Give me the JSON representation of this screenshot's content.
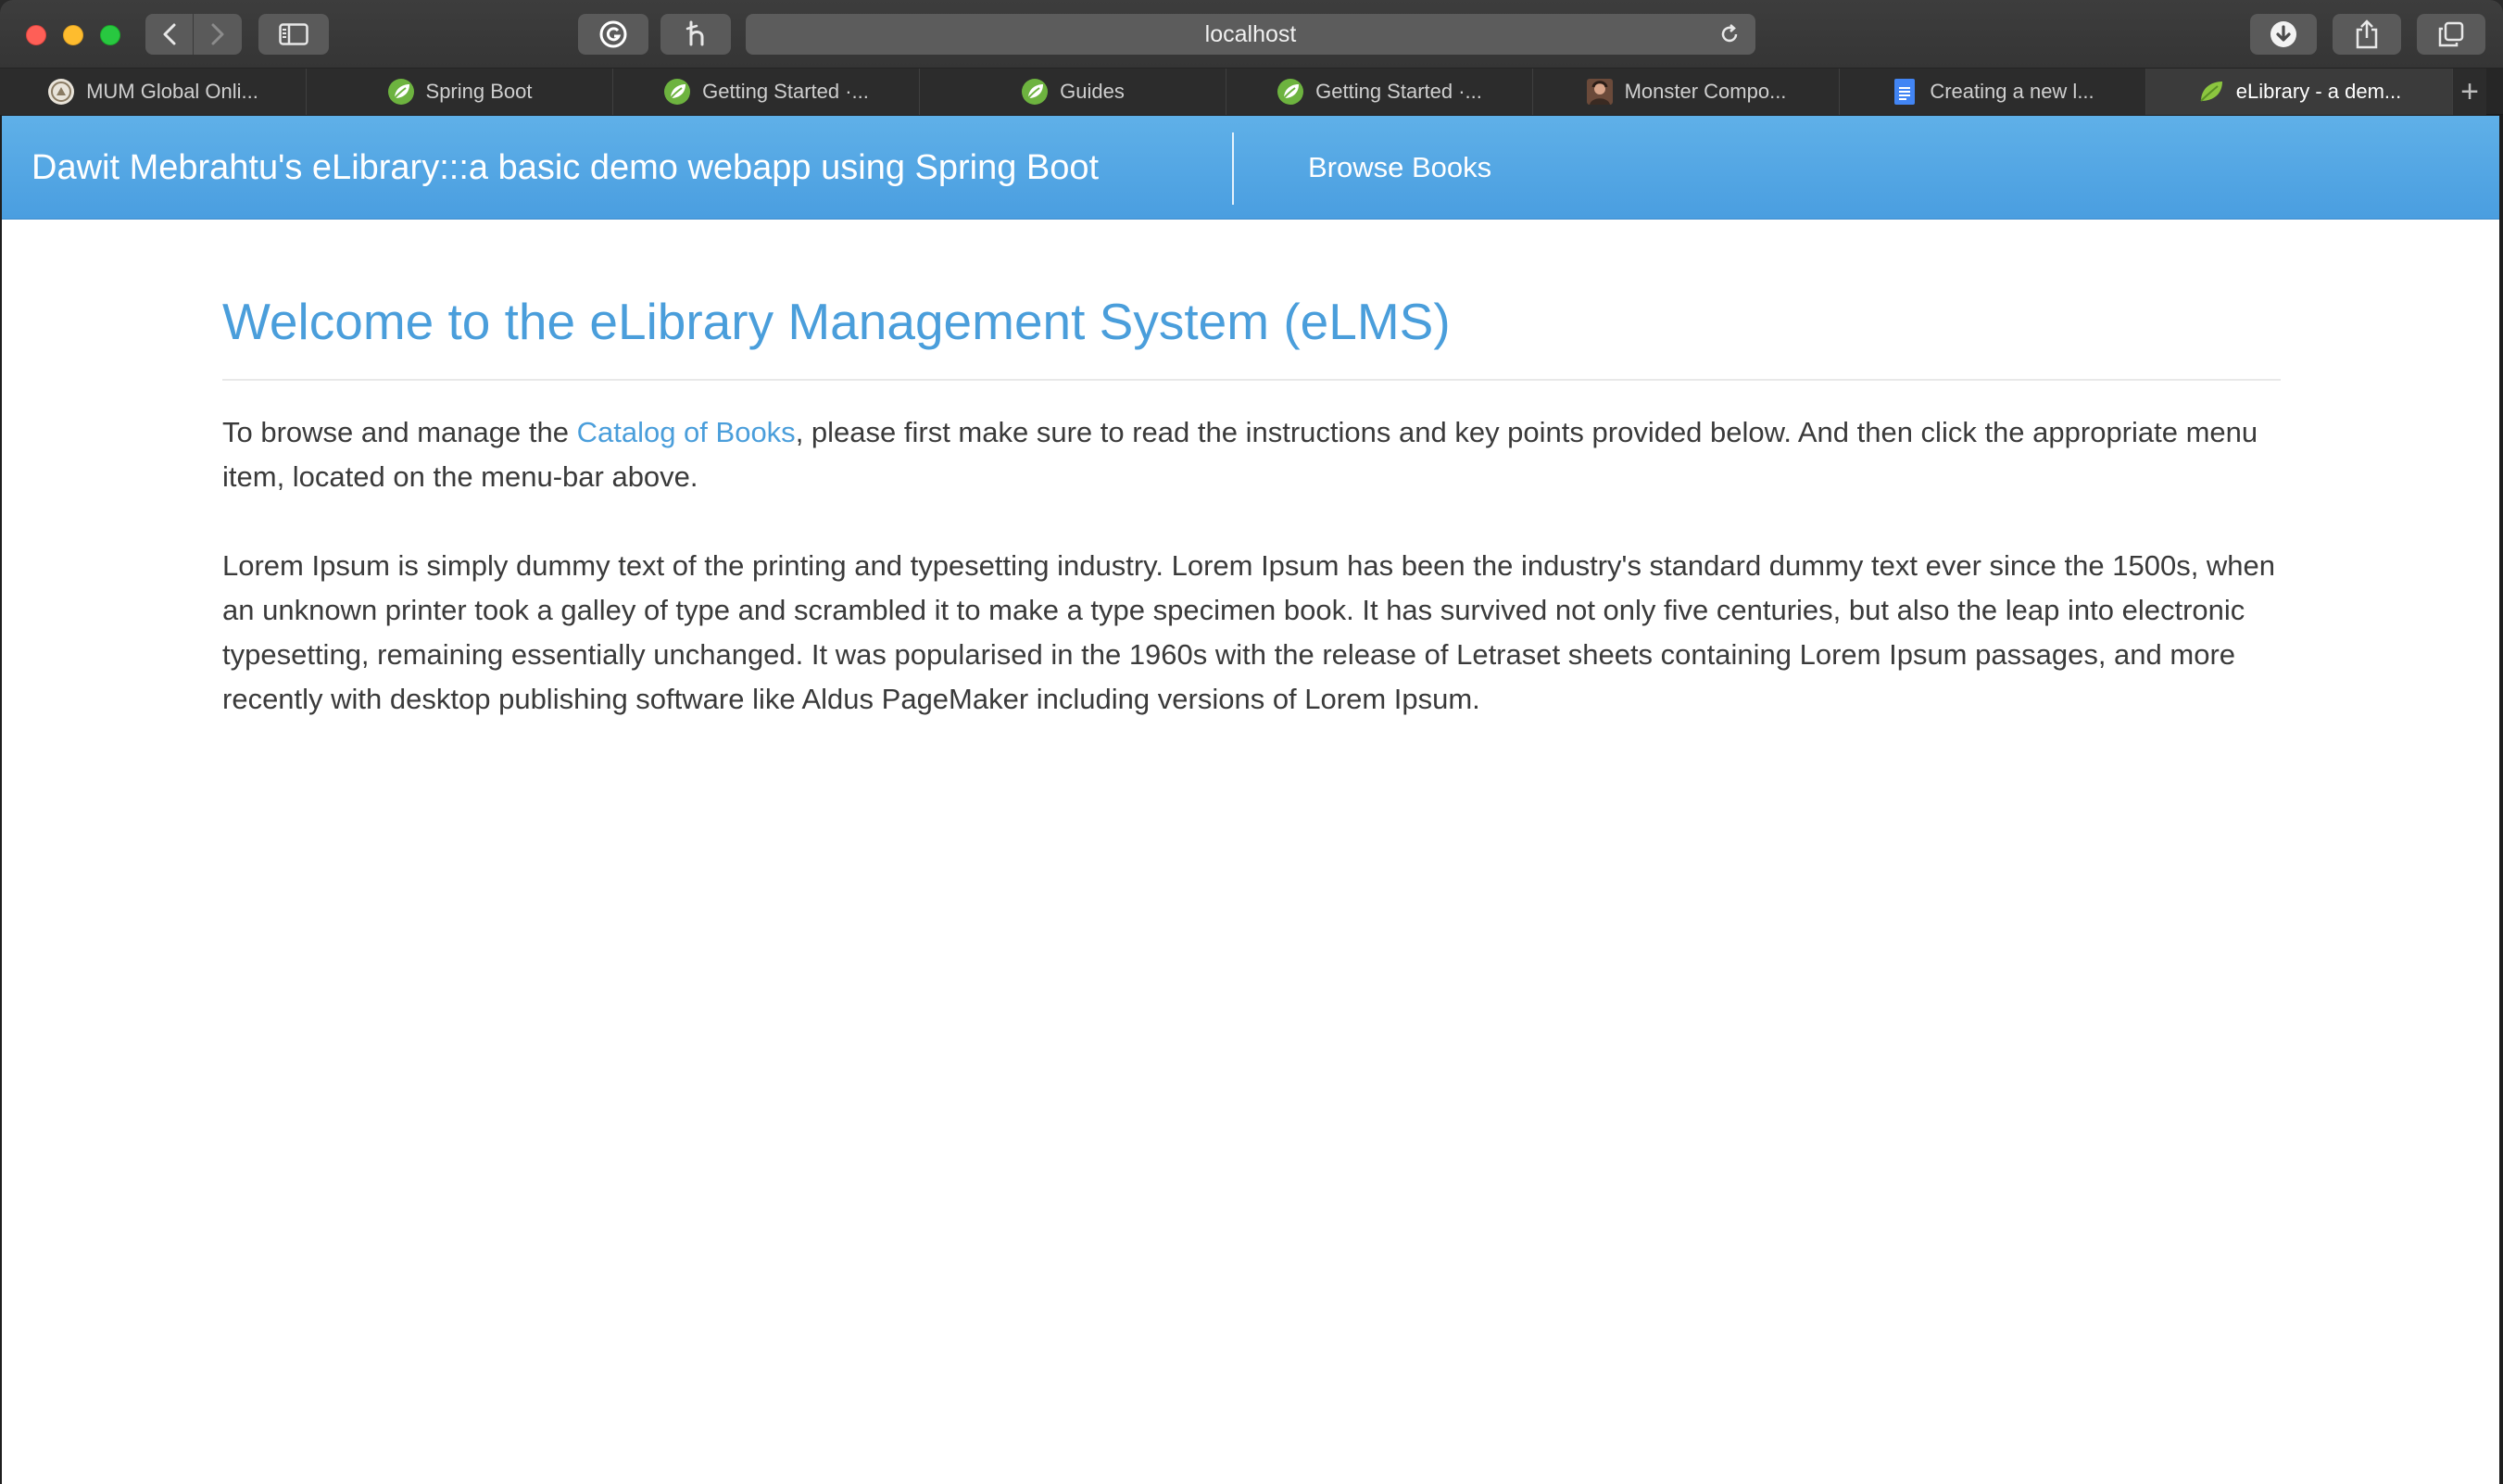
{
  "browser": {
    "url": "localhost",
    "tabs": [
      {
        "label": "MUM Global Onli...",
        "icon": "mum-favicon"
      },
      {
        "label": "Spring Boot",
        "icon": "spring-leaf-icon"
      },
      {
        "label": "Getting Started ·...",
        "icon": "spring-leaf-icon"
      },
      {
        "label": "Guides",
        "icon": "spring-leaf-icon"
      },
      {
        "label": "Getting Started ·...",
        "icon": "spring-leaf-icon"
      },
      {
        "label": "Monster Compo...",
        "icon": "avatar-favicon"
      },
      {
        "label": "Creating a new l...",
        "icon": "google-docs-icon"
      },
      {
        "label": "eLibrary - a dem...",
        "icon": "spring-leaf-icon",
        "active": true
      }
    ],
    "new_tab": "+"
  },
  "navbar": {
    "brand": "Dawit Mebrahtu's eLibrary:::a basic demo webapp using Spring Boot",
    "browse_books": "Browse Books"
  },
  "main": {
    "title": "Welcome to the eLibrary Management System (eLMS)",
    "intro_before": "To browse and manage the ",
    "intro_link": "Catalog of Books",
    "intro_after": ", please first make sure to read the instructions and key points provided below. And then click the appropriate menu item, located on the menu-bar above.",
    "lorem": "Lorem Ipsum is simply dummy text of the printing and typesetting industry. Lorem Ipsum has been the industry's standard dummy text ever since the 1500s, when an unknown printer took a galley of type and scrambled it to make a type specimen book. It has survived not only five centuries, but also the leap into electronic typesetting, remaining essentially unchanged. It was popularised in the 1960s with the release of Letraset sheets containing Lorem Ipsum passages, and more recently with desktop publishing software like Aldus PageMaker including versions of Lorem Ipsum."
  },
  "colors": {
    "navbar": "#4a9ee0",
    "accent": "#4a9edb",
    "text": "#3a3a3a"
  }
}
